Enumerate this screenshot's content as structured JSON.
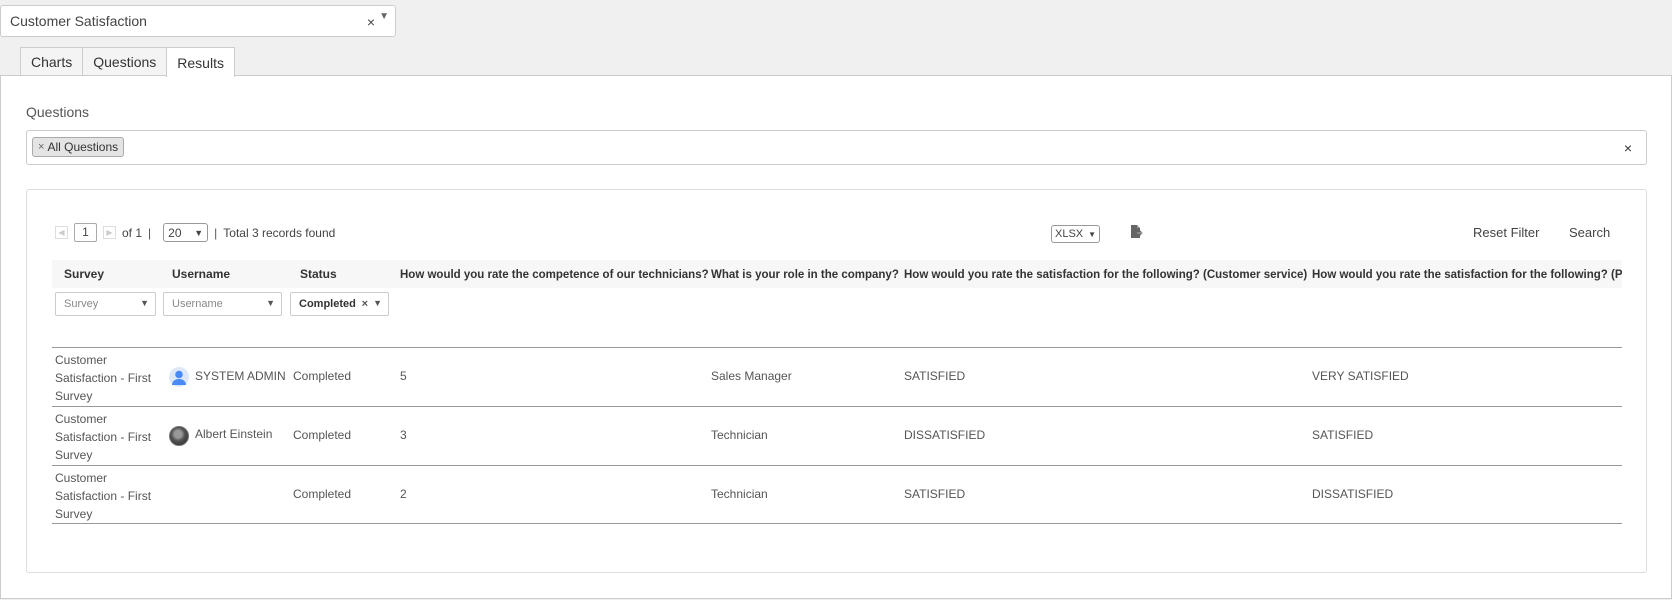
{
  "survey_select": {
    "value": "Customer Satisfaction",
    "clear": "×",
    "arrow": "▼"
  },
  "tabs": [
    {
      "label": "Charts"
    },
    {
      "label": "Questions"
    },
    {
      "label": "Results",
      "active": true
    }
  ],
  "questions": {
    "label": "Questions",
    "tag": "All Questions",
    "tag_x": "×",
    "clear": "×"
  },
  "pager": {
    "page": "1",
    "of": "of 1",
    "sep": "|",
    "page_size": "20",
    "total": "Total 3 records found"
  },
  "export": {
    "format": "XLSX"
  },
  "actions": {
    "reset": "Reset Filter",
    "search": "Search"
  },
  "grid": {
    "headers": {
      "survey": "Survey",
      "username": "Username",
      "status": "Status",
      "q1": "How would you rate the competence of our technicians?",
      "q2": "What is your role in the company?",
      "q3": "How would you rate the satisfaction for the following? (Customer service)",
      "q4": "How would you rate the satisfaction for the following? (P"
    },
    "filters": {
      "survey": "Survey",
      "username": "Username",
      "status": "Completed"
    },
    "rows": [
      {
        "survey": "Customer Satisfaction - First Survey",
        "username": "SYSTEM ADMIN",
        "status": "Completed",
        "q1": "5",
        "q2": "Sales Manager",
        "q3": "SATISFIED",
        "q4": "VERY SATISFIED"
      },
      {
        "survey": "Customer Satisfaction - First Survey",
        "username": "Albert Einstein",
        "status": "Completed",
        "q1": "3",
        "q2": "Technician",
        "q3": "DISSATISFIED",
        "q4": "SATISFIED"
      },
      {
        "survey": "Customer Satisfaction - First Survey",
        "username": "",
        "status": "Completed",
        "q1": "2",
        "q2": "Technician",
        "q3": "SATISFIED",
        "q4": "DISSATISFIED"
      }
    ]
  }
}
